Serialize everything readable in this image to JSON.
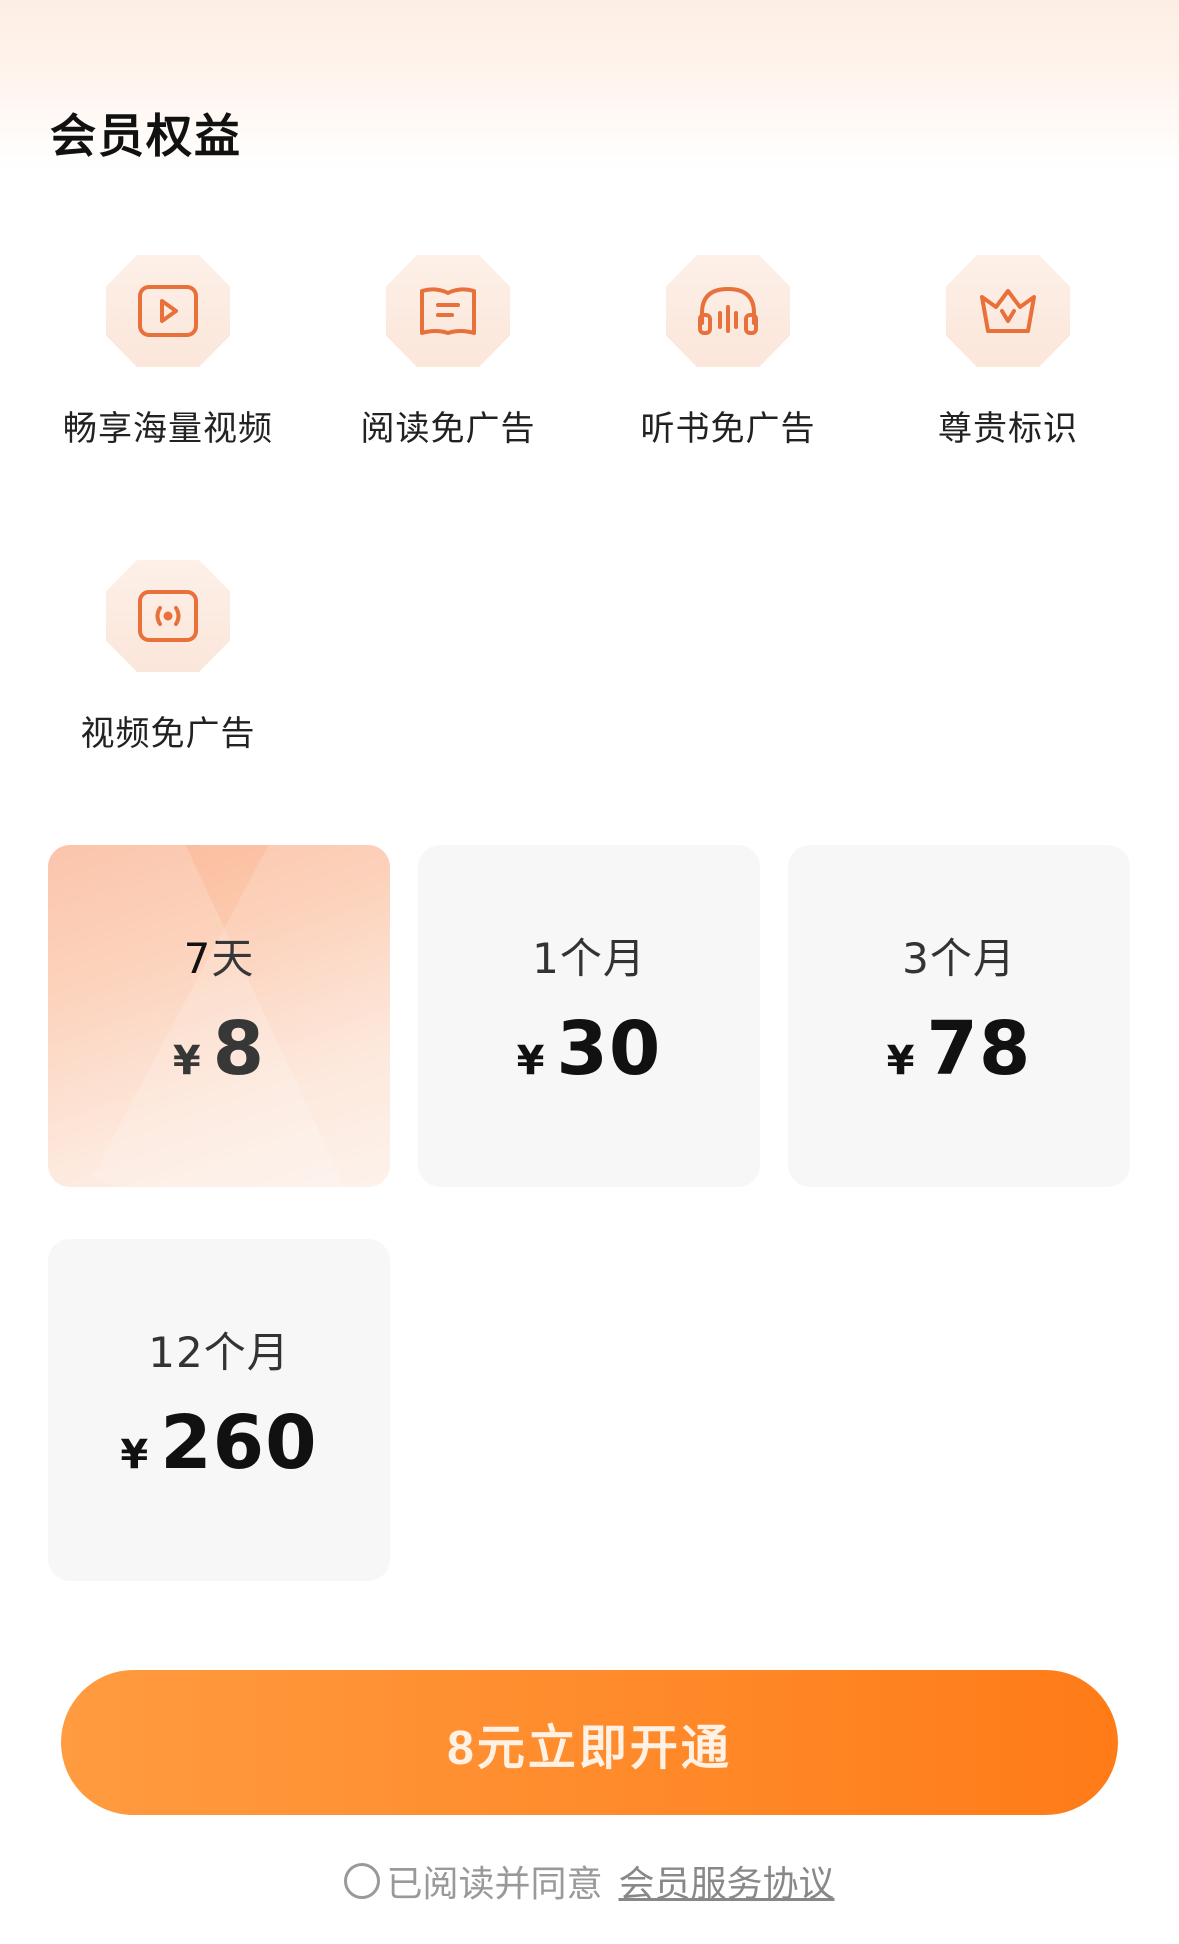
{
  "section": {
    "title": "会员权益"
  },
  "benefits": [
    {
      "label": "畅享海量视频",
      "icon": "video-play-icon"
    },
    {
      "label": "阅读免广告",
      "icon": "book-icon"
    },
    {
      "label": "听书免广告",
      "icon": "headphones-icon"
    },
    {
      "label": "尊贵标识",
      "icon": "crown-icon"
    },
    {
      "label": "视频免广告",
      "icon": "broadcast-screen-icon"
    }
  ],
  "plans": [
    {
      "duration": "7天",
      "currency": "¥",
      "price": "8",
      "selected": true
    },
    {
      "duration": "1个月",
      "currency": "¥",
      "price": "30",
      "selected": false
    },
    {
      "duration": "3个月",
      "currency": "¥",
      "price": "78",
      "selected": false
    },
    {
      "duration": "12个月",
      "currency": "¥",
      "price": "260",
      "selected": false
    }
  ],
  "cta": {
    "label": "8元立即开通"
  },
  "agreement": {
    "text": "已阅读并同意",
    "link": "会员服务协议",
    "checked": false
  },
  "colors": {
    "accent": "#FF8A2A",
    "icon_stroke": "#E8703A",
    "icon_bg": "#FBE6DA"
  }
}
